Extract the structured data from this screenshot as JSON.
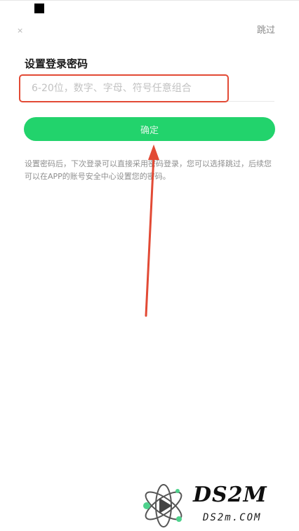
{
  "header": {
    "close_icon": "close-icon",
    "skip_label": "跳过"
  },
  "form": {
    "title": "设置登录密码",
    "password_placeholder": "6-20位，数字、字母、符号任意组合",
    "password_value": "",
    "confirm_label": "确定"
  },
  "hint": {
    "text": "设置密码后，下次登录可以直接采用密码登录，您可以选择跳过，后续您可以在APP的账号安全中心设置您的密码。"
  },
  "watermark": {
    "brand": "DS2M",
    "domain": "DS2m.COM"
  },
  "colors": {
    "accent": "#22d36c",
    "annotation": "#e24a35"
  }
}
